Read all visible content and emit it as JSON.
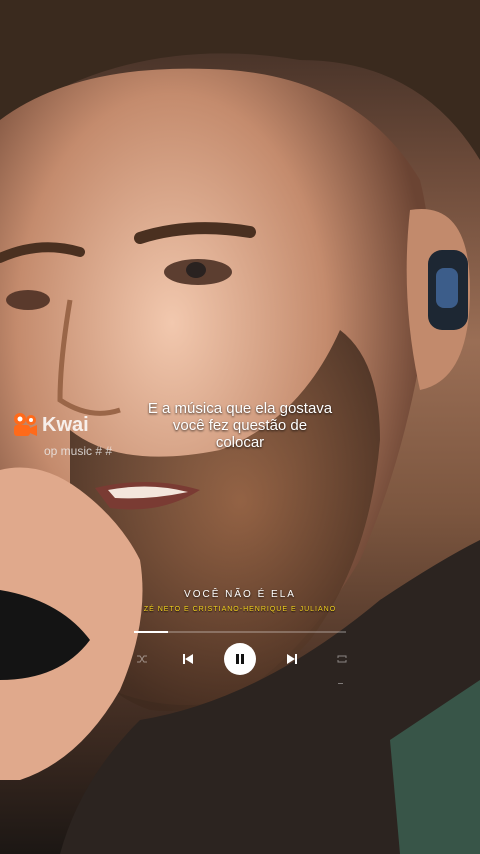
{
  "overlay": {
    "brand": "Kwai",
    "handle": "op music # #",
    "caption": [
      "E a música que ela gostava",
      "você fez questão de",
      "colocar"
    ]
  },
  "player": {
    "song_title": "VOCÊ NÃO É ELA",
    "artists": "ZÉ NETO E CRISTIANO-HENRIQUE E JULIANO",
    "progress": 0.16,
    "state": "playing",
    "icons": [
      "shuffle-icon",
      "previous-icon",
      "pause-icon",
      "next-icon",
      "repeat-icon"
    ]
  },
  "colors": {
    "artist_text": "#f3d21d",
    "brand_orange": "#ff6a1a",
    "control_bg": "#ffffff"
  }
}
